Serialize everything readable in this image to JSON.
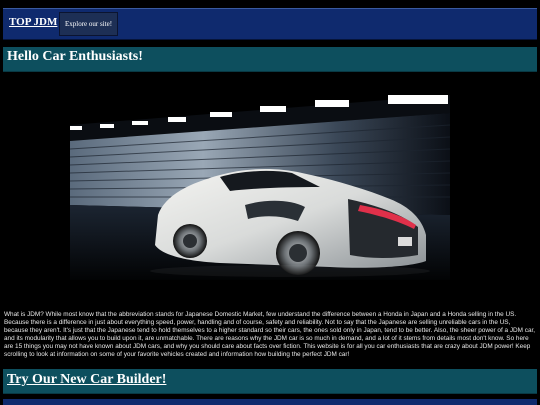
{
  "nav": {
    "brand": "TOP JDM",
    "explore_button": "Explore our site!"
  },
  "hero": {
    "heading": "Hello Car Enthusiasts!"
  },
  "intro": {
    "text": "What is JDM? While most know that the abbreviation stands for Japanese Domestic Market, few understand the difference between a Honda in Japan and a Honda selling in the US. Because there is a difference in just about everything speed, power, handling and of course, safety and reliability. Not to say that the Japanese are selling unreliable cars in the US, because they aren't. It's just that the Japanese tend to hold themselves to a higher standard so their cars, the ones sold only in Japan, tend to be better. Also, the sheer power of a JDM car, and its modularity that allows you to build upon it, are unmatchable. There are reasons why the JDM car is so much in demand, and a lot of it stems from details most don't know. So here are 15 things you may not have known about JDM cars, and why you should care about facts over fiction. This website is for all you car enthusiasts that are crazy about JDM power! Keep scrolling to look at information on some of your favorite vehicles created and information how building the perfect JDM car!"
  },
  "builder": {
    "link": "Try Our New Car Builder!"
  },
  "colors": {
    "nav_bg": "#0f2a6e",
    "section_bg": "#0d4f5e",
    "page_bg": "#000000",
    "car_body": "#e9e9e6",
    "tail_light": "#e0304a"
  },
  "icons": {
    "hero_image": "white-supercar-in-tunnel"
  }
}
